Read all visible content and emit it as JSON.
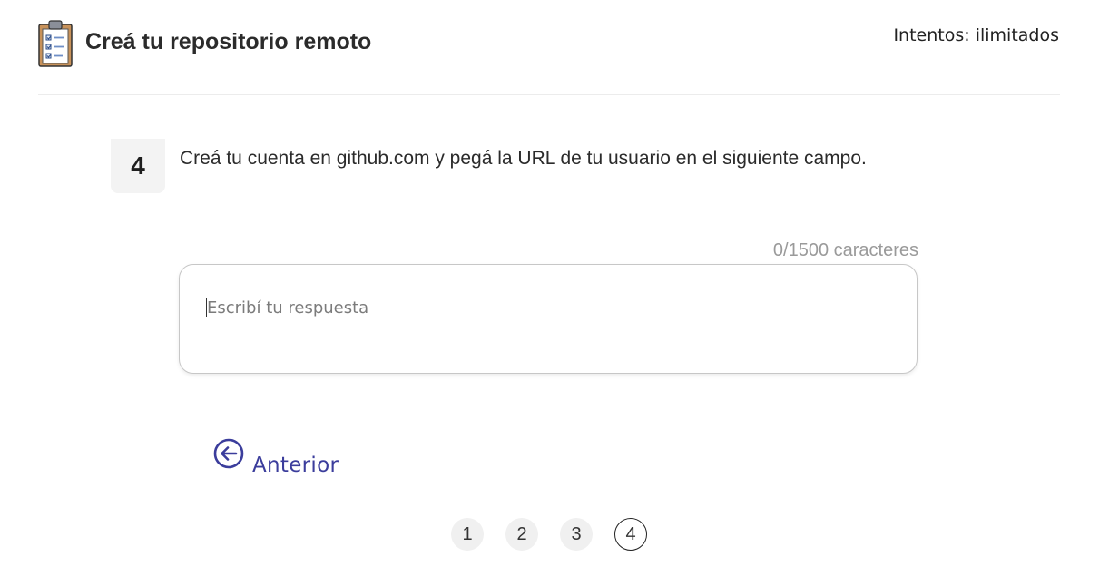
{
  "header": {
    "title": "Creá tu repositorio remoto",
    "attempts": "Intentos: ilimitados",
    "icon": "clipboard-checklist-icon"
  },
  "question": {
    "number": "4",
    "text": "Creá tu cuenta en github.com y pegá la URL de tu usuario en el siguiente campo."
  },
  "answer": {
    "counter": "0/1500 caracteres",
    "placeholder": "Escribí tu respuesta",
    "value": ""
  },
  "navigation": {
    "back_label": "Anterior",
    "back_icon": "arrow-left-circle-icon",
    "accent_color": "#3b3d9c"
  },
  "pagination": {
    "pages": [
      "1",
      "2",
      "3",
      "4"
    ],
    "current": "4"
  }
}
